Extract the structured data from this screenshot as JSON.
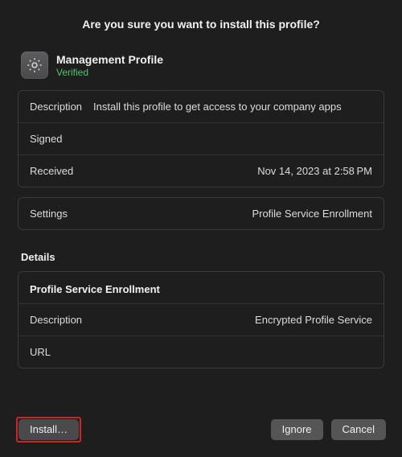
{
  "dialog": {
    "title": "Are you sure you want to install this profile?"
  },
  "profile": {
    "name": "Management Profile",
    "status": "Verified"
  },
  "info": {
    "description_label": "Description",
    "description_value": "Install this profile to get access to your company apps",
    "signed_label": "Signed",
    "signed_value": "",
    "received_label": "Received",
    "received_value": "Nov 14, 2023 at 2:58 PM"
  },
  "settings": {
    "label": "Settings",
    "value": "Profile Service Enrollment"
  },
  "details": {
    "header": "Details",
    "group_title": "Profile Service Enrollment",
    "description_label": "Description",
    "description_value": "Encrypted Profile Service",
    "url_label": "URL",
    "url_value": ""
  },
  "buttons": {
    "install": "Install…",
    "ignore": "Ignore",
    "cancel": "Cancel"
  }
}
